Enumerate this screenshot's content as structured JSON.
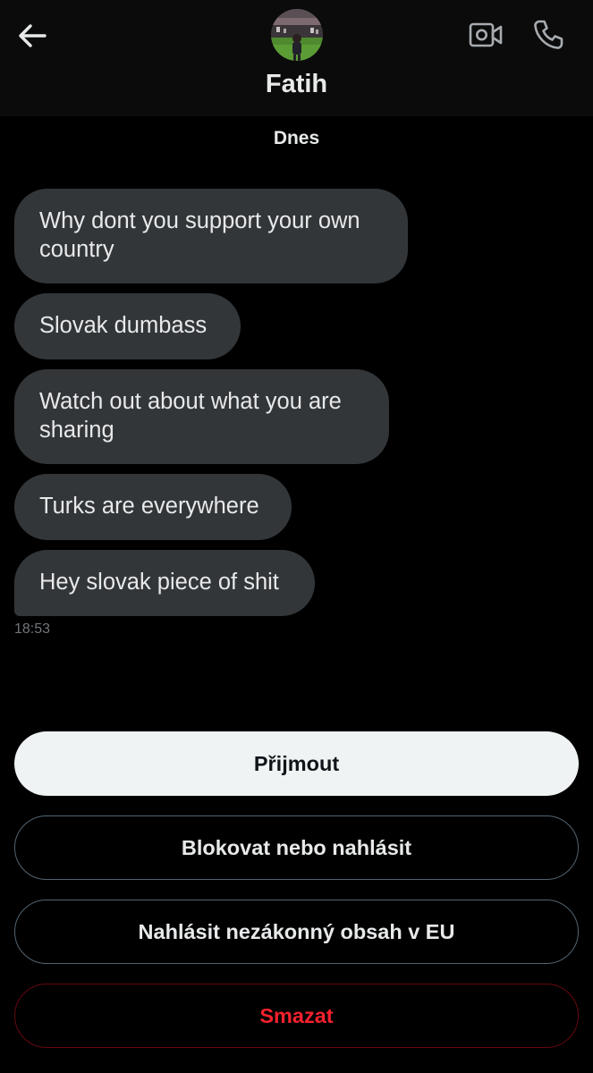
{
  "header": {
    "contact_name": "Fatih"
  },
  "conversation": {
    "date_separator": "Dnes",
    "messages": [
      {
        "text": "Why dont you support your own country"
      },
      {
        "text": "Slovak dumbass"
      },
      {
        "text": "Watch out about what you are sharing"
      },
      {
        "text": "Turks are everywhere"
      },
      {
        "text": "Hey slovak piece of shit"
      }
    ],
    "last_message_time": "18:53"
  },
  "actions": {
    "accept_label": "Přijmout",
    "block_label": "Blokovat nebo nahlásit",
    "report_label": "Nahlásit nezákonný obsah v EU",
    "delete_label": "Smazat"
  },
  "icons": {
    "back": "arrow-left-icon",
    "video": "video-call-icon",
    "phone": "phone-call-icon"
  },
  "colors": {
    "background": "#000000",
    "bubble": "#333639",
    "accept_button": "#eff3f4",
    "delete_text": "#f4212e",
    "outline_border": "#536471"
  }
}
